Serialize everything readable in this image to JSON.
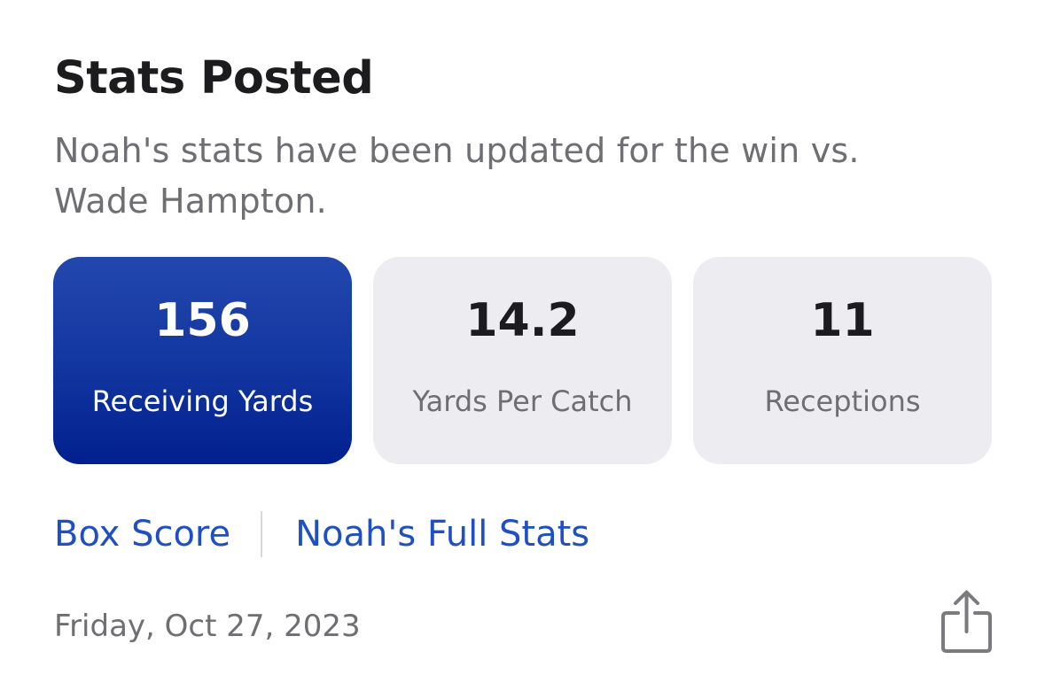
{
  "card": {
    "title": "Stats Posted",
    "description": "Noah's stats have been updated for the win vs. Wade Hampton."
  },
  "stats": [
    {
      "value": "156",
      "label": "Receiving Yards",
      "highlighted": true
    },
    {
      "value": "14.2",
      "label": "Yards Per Catch",
      "highlighted": false
    },
    {
      "value": "11",
      "label": "Receptions",
      "highlighted": false
    }
  ],
  "links": {
    "box_score": "Box Score",
    "full_stats": "Noah's Full Stats"
  },
  "footer": {
    "date": "Friday, Oct 27, 2023",
    "share_icon": "share-icon"
  },
  "colors": {
    "accent_blue": "#1f4fc4",
    "tile_highlight_top": "#2247ad",
    "tile_highlight_bottom": "#01208f",
    "tile_neutral": "#ececf1",
    "title_text": "#1c1c1e",
    "secondary_text": "#6e6e73"
  }
}
